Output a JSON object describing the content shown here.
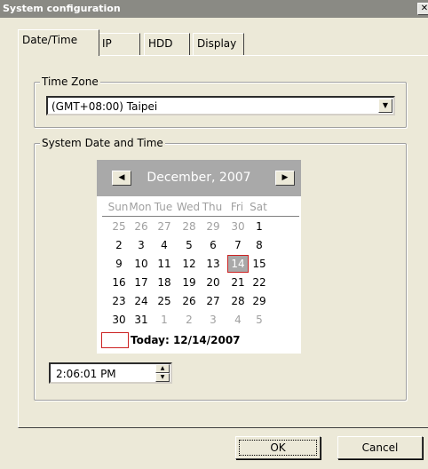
{
  "window": {
    "title": "System configuration",
    "close_glyph": "✕"
  },
  "tabs": [
    {
      "label": "Date/Time",
      "active": true
    },
    {
      "label": "IP",
      "active": false
    },
    {
      "label": "HDD",
      "active": false
    },
    {
      "label": "Display",
      "active": false
    }
  ],
  "time_zone": {
    "group_label": "Time Zone",
    "selected": "(GMT+08:00)  Taipei",
    "arrow_icon": "chevron-down-icon"
  },
  "date_time": {
    "group_label": "System Date and Time",
    "calendar": {
      "month_title": "December, 2007",
      "prev_icon": "chevron-left-icon",
      "next_icon": "chevron-right-icon",
      "weekdays": [
        "Sun",
        "Mon",
        "Tue",
        "Wed",
        "Thu",
        "Fri",
        "Sat"
      ],
      "weeks": [
        [
          {
            "d": "25",
            "m": true
          },
          {
            "d": "26",
            "m": true
          },
          {
            "d": "27",
            "m": true
          },
          {
            "d": "28",
            "m": true
          },
          {
            "d": "29",
            "m": true
          },
          {
            "d": "30",
            "m": true
          },
          {
            "d": "1"
          }
        ],
        [
          {
            "d": "2"
          },
          {
            "d": "3"
          },
          {
            "d": "4"
          },
          {
            "d": "5"
          },
          {
            "d": "6"
          },
          {
            "d": "7"
          },
          {
            "d": "8"
          }
        ],
        [
          {
            "d": "9"
          },
          {
            "d": "10"
          },
          {
            "d": "11"
          },
          {
            "d": "12"
          },
          {
            "d": "13"
          },
          {
            "d": "14",
            "sel": true
          },
          {
            "d": "15"
          }
        ],
        [
          {
            "d": "16"
          },
          {
            "d": "17"
          },
          {
            "d": "18"
          },
          {
            "d": "19"
          },
          {
            "d": "20"
          },
          {
            "d": "21"
          },
          {
            "d": "22"
          }
        ],
        [
          {
            "d": "23"
          },
          {
            "d": "24"
          },
          {
            "d": "25"
          },
          {
            "d": "26"
          },
          {
            "d": "27"
          },
          {
            "d": "28"
          },
          {
            "d": "29"
          }
        ],
        [
          {
            "d": "30"
          },
          {
            "d": "31"
          },
          {
            "d": "1",
            "m": true
          },
          {
            "d": "2",
            "m": true
          },
          {
            "d": "3",
            "m": true
          },
          {
            "d": "4",
            "m": true
          },
          {
            "d": "5",
            "m": true
          }
        ]
      ],
      "today_label": "Today: 12/14/2007",
      "selected_color": "#a9a9a9",
      "today_border_color": "#cc2222"
    },
    "time_value": "2:06:01 PM"
  },
  "buttons": {
    "ok": "OK",
    "cancel": "Cancel"
  }
}
